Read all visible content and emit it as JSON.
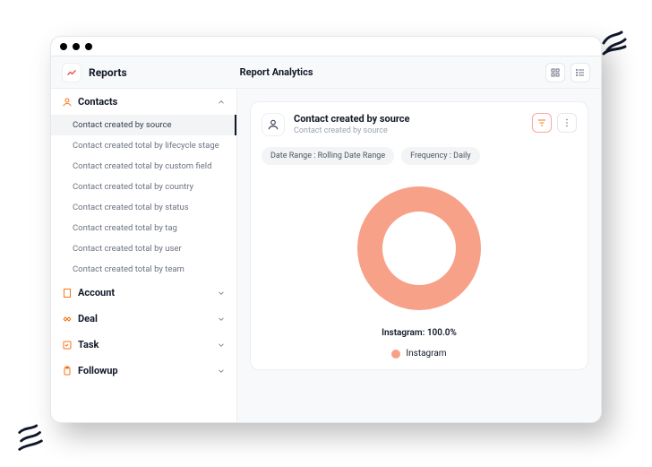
{
  "header": {
    "brand_label": "Reports",
    "center_title": "Report Analytics"
  },
  "sidebar": {
    "sections": [
      {
        "id": "contacts",
        "label": "Contacts",
        "expanded": true,
        "icon": "user-icon",
        "icon_color": "#f97316",
        "items": [
          {
            "label": "Contact created by source",
            "active": true
          },
          {
            "label": "Contact created total by lifecycle stage",
            "active": false
          },
          {
            "label": "Contact created total by custom field",
            "active": false
          },
          {
            "label": "Contact created total by country",
            "active": false
          },
          {
            "label": "Contact created total by status",
            "active": false
          },
          {
            "label": "Contact created total by tag",
            "active": false
          },
          {
            "label": "Contact created total by user",
            "active": false
          },
          {
            "label": "Contact created total by team",
            "active": false
          }
        ]
      },
      {
        "id": "account",
        "label": "Account",
        "expanded": false,
        "icon": "building-icon",
        "icon_color": "#f97316"
      },
      {
        "id": "deal",
        "label": "Deal",
        "expanded": false,
        "icon": "handshake-icon",
        "icon_color": "#f97316"
      },
      {
        "id": "task",
        "label": "Task",
        "expanded": false,
        "icon": "checklist-icon",
        "icon_color": "#f97316"
      },
      {
        "id": "followup",
        "label": "Followup",
        "expanded": false,
        "icon": "clipboard-icon",
        "icon_color": "#f97316"
      }
    ]
  },
  "card": {
    "title": "Contact created by source",
    "subtitle": "Contact created by source",
    "chips": [
      {
        "label": "Date Range : Rolling Date Range"
      },
      {
        "label": "Frequency : Daily"
      }
    ]
  },
  "chart_data": {
    "type": "pie",
    "title": "",
    "series": [
      {
        "name": "Instagram",
        "value": 100.0,
        "color": "#f7a188"
      }
    ],
    "center_label": "Instagram: 100.0%",
    "legend": [
      "Instagram"
    ],
    "donut": true
  },
  "colors": {
    "accent": "#f7a188",
    "icon_accent": "#f97316"
  }
}
